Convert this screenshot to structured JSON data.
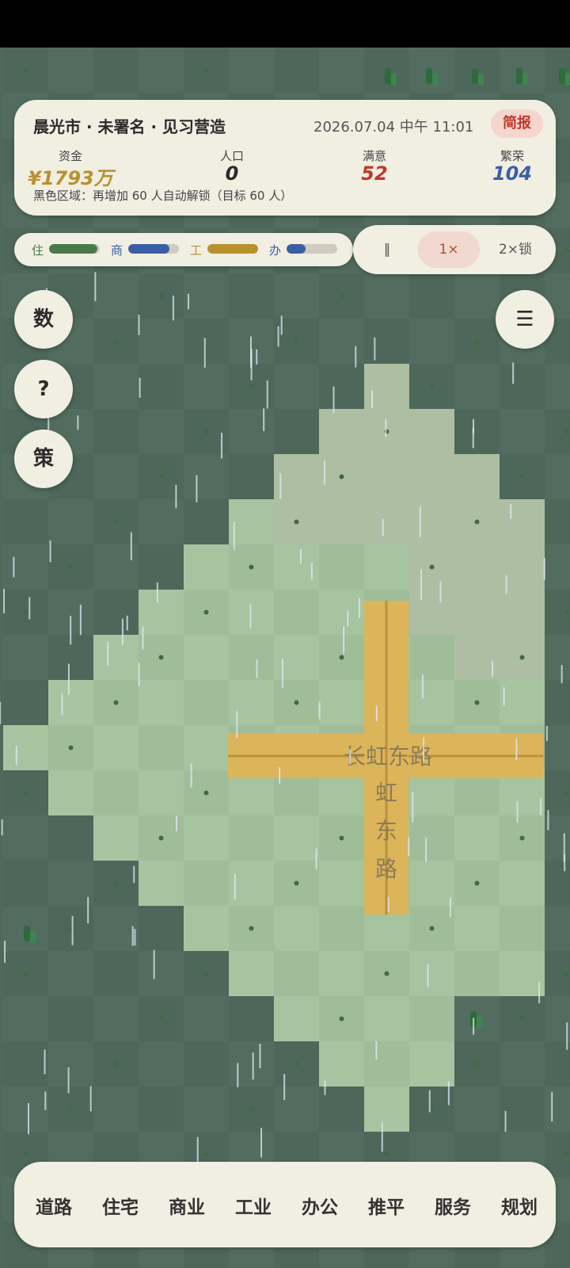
{
  "header": {
    "city_title": "晨光市 · 未署名 · 见习营造",
    "datetime": "2026.07.04 中午 11:01",
    "report_label": "简报"
  },
  "stats": [
    {
      "label": "资金",
      "value": "¥1793万",
      "color": "#b8912e"
    },
    {
      "label": "人口",
      "value": "0",
      "color": "#2b2b2b"
    },
    {
      "label": "满意",
      "value": "52",
      "color": "#c0392b"
    },
    {
      "label": "繁荣",
      "value": "104",
      "color": "#3b5fa6"
    }
  ],
  "unlock_hint": "黑色区域：再增加 60 人自动解锁（目标 60 人）",
  "demand": [
    {
      "label": "住",
      "level": 0.95,
      "color": "#4a7a4a"
    },
    {
      "label": "商",
      "level": 0.82,
      "color": "#3b5fa6"
    },
    {
      "label": "工",
      "level": 1.0,
      "color": "#b8912e"
    },
    {
      "label": "办",
      "level": 0.38,
      "color": "#3b5fa6"
    }
  ],
  "speed": {
    "pause": "‖",
    "normal": "1×",
    "fast": "2×锁",
    "active": "1×"
  },
  "side_buttons": {
    "stats": "数",
    "help": "?",
    "policy": "策",
    "menu": "☰"
  },
  "roads": {
    "horizontal": "长虹东路",
    "vertical": "虹东路"
  },
  "toolbar": [
    "道路",
    "住宅",
    "商业",
    "工业",
    "办公",
    "推平",
    "服务",
    "规划"
  ]
}
